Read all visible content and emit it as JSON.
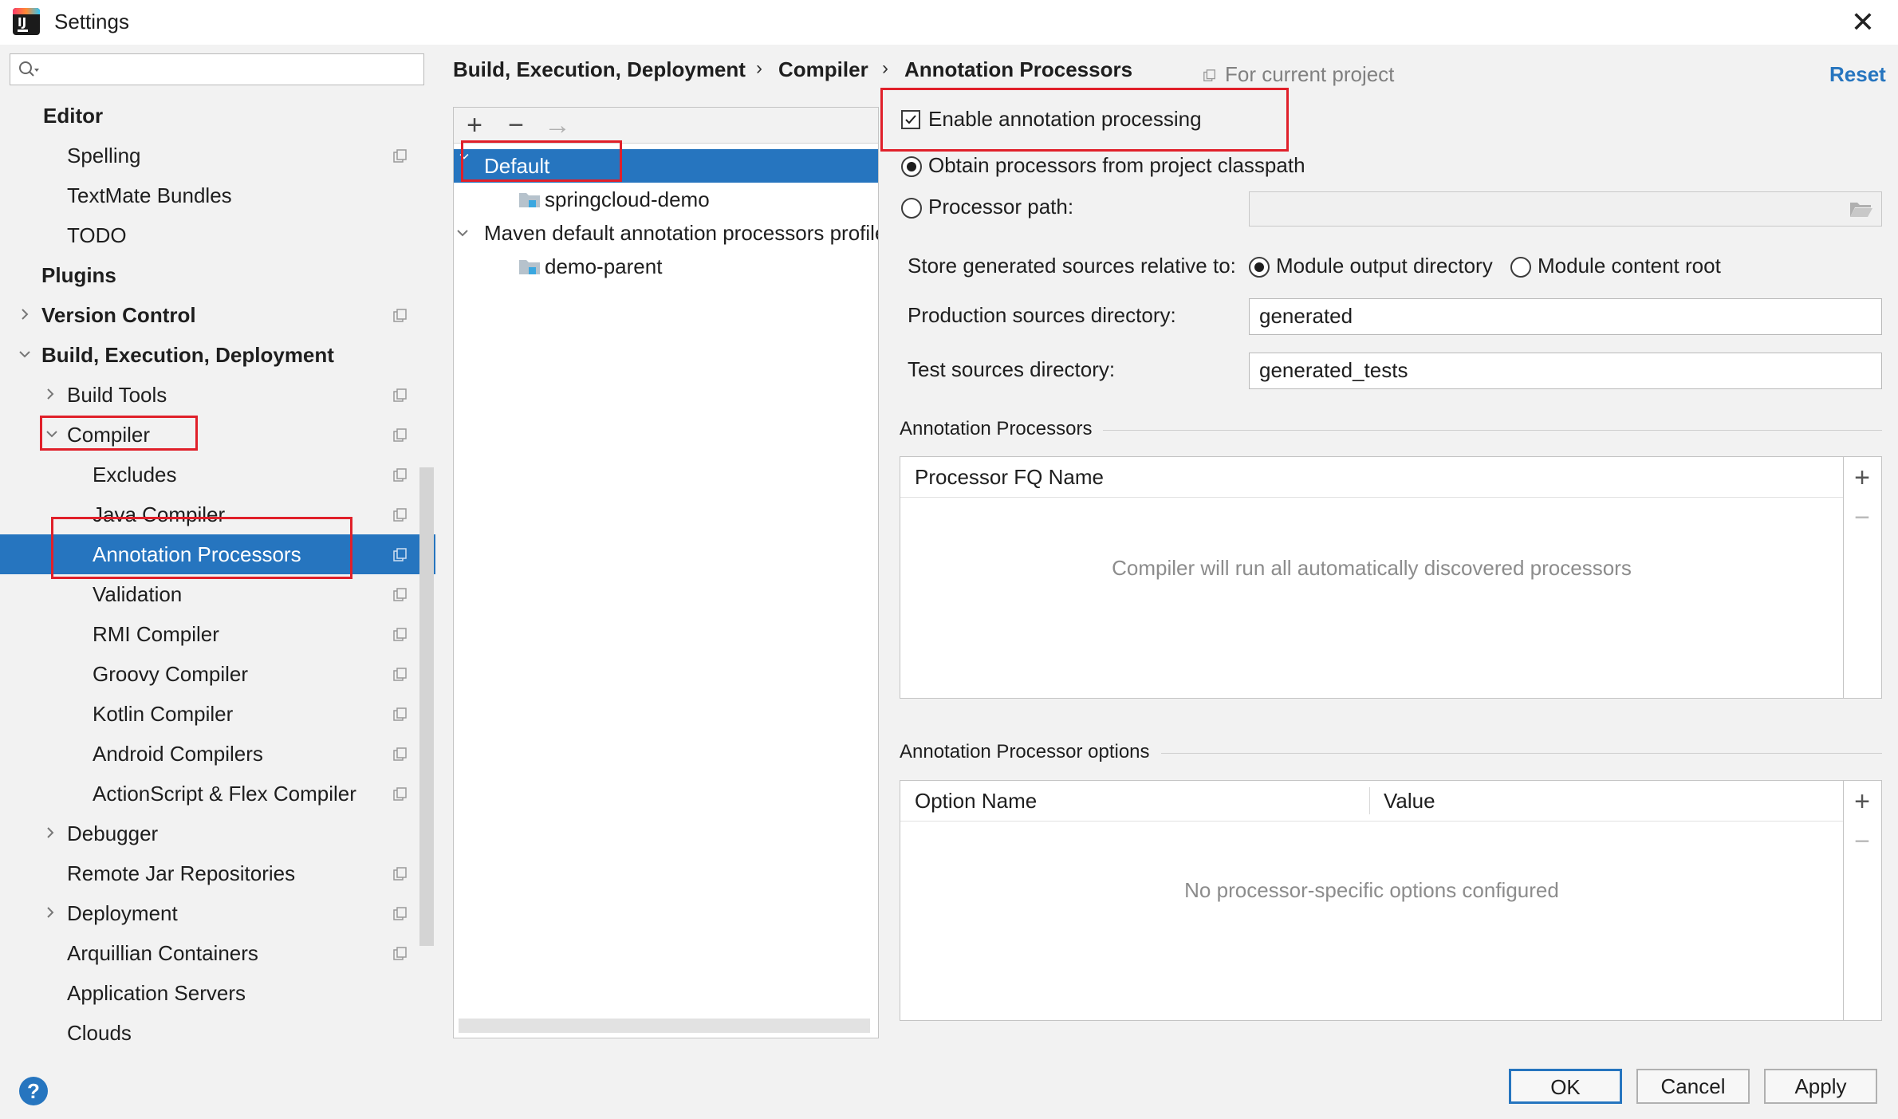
{
  "window": {
    "title": "Settings"
  },
  "search": {
    "placeholder": ""
  },
  "sidebar": {
    "items": [
      {
        "label": "Editor",
        "bold": true
      },
      {
        "label": "Spelling"
      },
      {
        "label": "TextMate Bundles"
      },
      {
        "label": "TODO"
      },
      {
        "label": "Plugins",
        "bold": true
      },
      {
        "label": "Version Control",
        "bold": true
      },
      {
        "label": "Build, Execution, Deployment",
        "bold": true
      },
      {
        "label": "Build Tools"
      },
      {
        "label": "Compiler"
      },
      {
        "label": "Excludes"
      },
      {
        "label": "Java Compiler"
      },
      {
        "label": "Annotation Processors",
        "selected": true
      },
      {
        "label": "Validation"
      },
      {
        "label": "RMI Compiler"
      },
      {
        "label": "Groovy Compiler"
      },
      {
        "label": "Kotlin Compiler"
      },
      {
        "label": "Android Compilers"
      },
      {
        "label": "ActionScript & Flex Compiler"
      },
      {
        "label": "Debugger"
      },
      {
        "label": "Remote Jar Repositories"
      },
      {
        "label": "Deployment"
      },
      {
        "label": "Arquillian Containers"
      },
      {
        "label": "Application Servers"
      },
      {
        "label": "Clouds"
      }
    ]
  },
  "breadcrumb": {
    "items": [
      "Build, Execution, Deployment",
      "Compiler",
      "Annotation Processors"
    ],
    "separator": "›",
    "scope": "For current project",
    "reset": "Reset"
  },
  "profiles": {
    "toolbar": {
      "add": "+",
      "remove": "−",
      "move": "→"
    },
    "rows": [
      {
        "label": "Default",
        "selected": true
      },
      {
        "label": "springcloud-demo"
      },
      {
        "label": "Maven default annotation processors profile"
      },
      {
        "label": "demo-parent"
      }
    ]
  },
  "settings": {
    "enable_label": "Enable annotation processing",
    "enable_checked": true,
    "obtain_label": "Obtain processors from project classpath",
    "processor_path_label": "Processor path:",
    "processor_path_value": "",
    "store_label": "Store generated sources relative to:",
    "module_output_label": "Module output directory",
    "module_content_label": "Module content root",
    "production_label": "Production sources directory:",
    "production_value": "generated",
    "test_label": "Test sources directory:",
    "test_value": "generated_tests"
  },
  "processors_table": {
    "title": "Annotation Processors",
    "column": "Processor FQ Name",
    "empty": "Compiler will run all automatically discovered processors",
    "add": "+",
    "remove": "−"
  },
  "options_table": {
    "title": "Annotation Processor options",
    "columns": [
      "Option Name",
      "Value"
    ],
    "empty": "No processor-specific options configured",
    "add": "+",
    "remove": "−"
  },
  "footer": {
    "help": "?",
    "ok": "OK",
    "cancel": "Cancel",
    "apply": "Apply"
  },
  "colors": {
    "selection": "#2675bf",
    "annotation_red": "#e0202a",
    "link": "#2675bf"
  }
}
